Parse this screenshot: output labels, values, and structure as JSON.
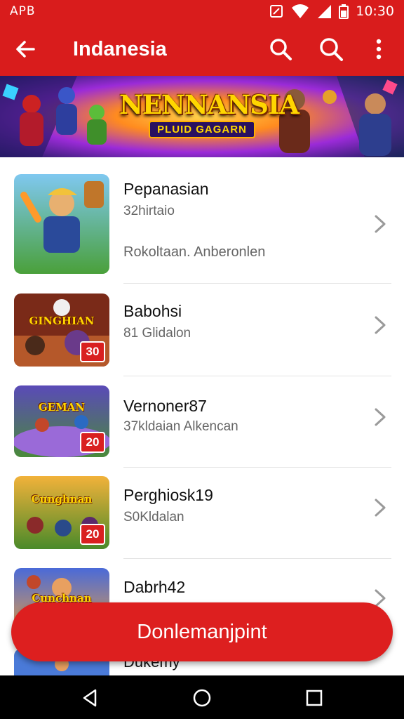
{
  "status_bar": {
    "carrier": "APB",
    "time": "10:30"
  },
  "app_bar": {
    "title": "Indanesia"
  },
  "banner": {
    "title": "NENNANSIA",
    "subtitle": "PLUID GAGARN"
  },
  "games": [
    {
      "name": "Pepanasian",
      "meta": "32hirtaio",
      "desc": "Rokoltaan. Anberonlen",
      "badge": "",
      "thumb_title": ""
    },
    {
      "name": "Babohsi",
      "meta": "81 Glidalon",
      "desc": "",
      "badge": "30",
      "thumb_title": "GINGHIAN"
    },
    {
      "name": "Vernoner87",
      "meta": "37kldaian Alkencan",
      "desc": "",
      "badge": "20",
      "thumb_title": "GEMAN"
    },
    {
      "name": "Perghiosk19",
      "meta": "S0Kldalan",
      "desc": "",
      "badge": "20",
      "thumb_title": "Cunghnan"
    },
    {
      "name": "Dabrh42",
      "meta": "",
      "desc": "",
      "badge": "",
      "thumb_title": "Cunchnan"
    },
    {
      "name": "Dukemy",
      "meta": "",
      "desc": "",
      "badge": "",
      "thumb_title": ""
    }
  ],
  "primary_action": {
    "label": "Donlemanjpint"
  },
  "icons": {
    "back": "arrow-left-icon",
    "search": "search-icon",
    "search2": "search-icon",
    "more": "more-vert-icon",
    "chevron": "chevron-right-icon",
    "nav_back": "nav-back-icon",
    "nav_home": "nav-home-icon",
    "nav_recent": "nav-recents-icon"
  },
  "colors": {
    "primary": "#d91c1c",
    "fab": "#dd1f1f",
    "text": "#111111",
    "subtext": "#666666"
  }
}
